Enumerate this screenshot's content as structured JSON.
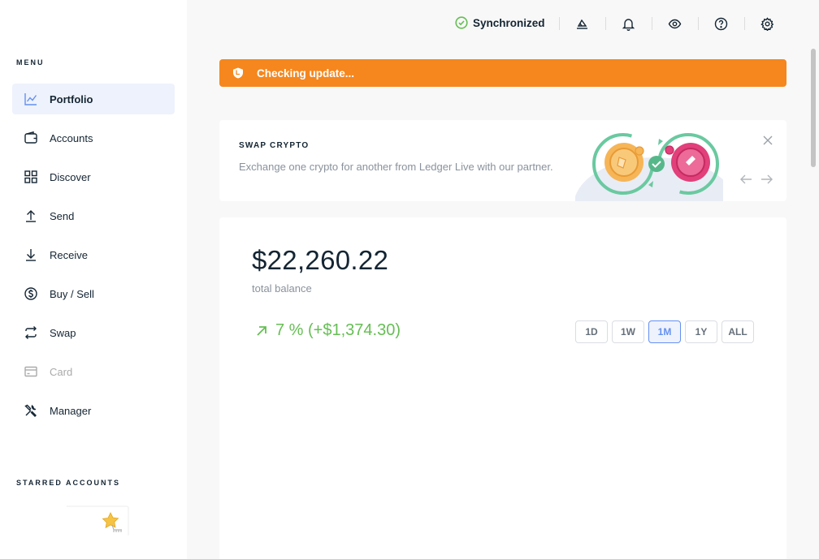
{
  "sidebar": {
    "menu_title": "MENU",
    "items": [
      {
        "label": "Portfolio",
        "icon": "chart-line-icon",
        "active": true
      },
      {
        "label": "Accounts",
        "icon": "wallet-icon"
      },
      {
        "label": "Discover",
        "icon": "grid-icon"
      },
      {
        "label": "Send",
        "icon": "arrow-up-icon"
      },
      {
        "label": "Receive",
        "icon": "arrow-down-icon"
      },
      {
        "label": "Buy / Sell",
        "icon": "dollar-circle-icon"
      },
      {
        "label": "Swap",
        "icon": "swap-arrows-icon"
      },
      {
        "label": "Card",
        "icon": "card-icon",
        "disabled": true
      },
      {
        "label": "Manager",
        "icon": "tools-icon"
      }
    ],
    "starred_title": "STARRED ACCOUNTS"
  },
  "topbar": {
    "sync_status": "Synchronized",
    "icons": [
      "clear-cache-icon",
      "bell-icon",
      "eye-icon",
      "help-icon",
      "gear-icon"
    ]
  },
  "update_banner": {
    "text": "Checking update...",
    "color": "#f5871e"
  },
  "swap_banner": {
    "title": "SWAP CRYPTO",
    "description": "Exchange one crypto for another from Ledger Live with our partner."
  },
  "balance": {
    "amount": "$22,260.22",
    "label": "total balance",
    "change": "7 % (+$1,374.30)",
    "change_color": "#66be54",
    "ranges": [
      "1D",
      "1W",
      "1M",
      "1Y",
      "ALL"
    ],
    "selected_range": "1M"
  },
  "colors": {
    "accent": "#6490f1",
    "positive": "#66be54",
    "warning": "#f5871e"
  }
}
